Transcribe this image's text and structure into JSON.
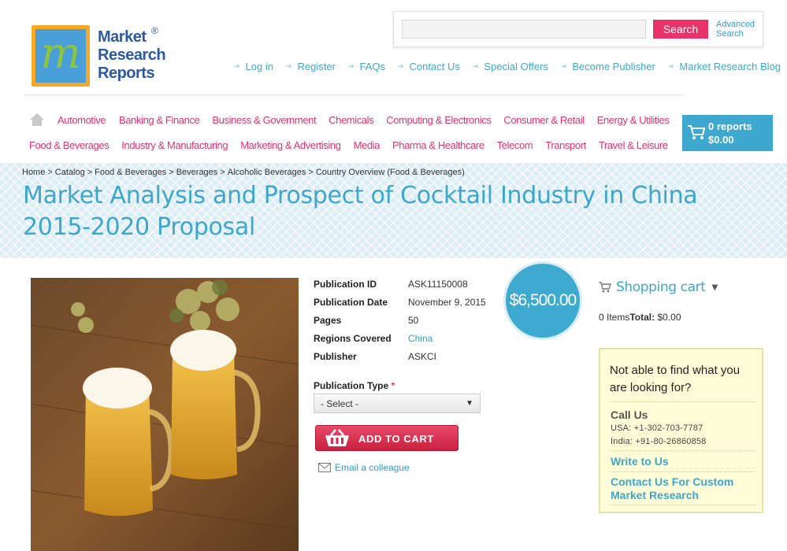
{
  "logo": {
    "line1": "Market",
    "line2": "Research",
    "line3": "Reports",
    "registered": "®"
  },
  "search": {
    "placeholder": "",
    "button": "Search",
    "advanced_line1": "Advanced",
    "advanced_line2": "Search"
  },
  "top_links": [
    "Log in",
    "Register",
    "FAQs",
    "Contact Us",
    "Special Offers",
    "Become Publisher",
    "Market Research Blog"
  ],
  "nav": {
    "row1": [
      "Automotive",
      "Banking & Finance",
      "Business & Government",
      "Chemicals",
      "Computing & Electronics",
      "Consumer & Retail",
      "Energy & Utilities"
    ],
    "row2": [
      "Food & Beverages",
      "Industry & Manufacturing",
      "Marketing & Advertising",
      "Media",
      "Pharma & Healthcare",
      "Telecom",
      "Transport",
      "Travel & Leisure"
    ]
  },
  "cart": {
    "count": "0 reports",
    "total": "$0.00"
  },
  "breadcrumb": [
    "Home",
    "Catalog",
    "Food & Beverages",
    "Beverages",
    "Alcoholic Beverages",
    "Country Overview (Food & Beverages)"
  ],
  "page_title": "Market Analysis and Prospect of Cocktail Industry in China 2015-2020 Proposal",
  "product": {
    "labels": {
      "publication_id": "Publication ID",
      "publication_date": "Publication Date",
      "pages": "Pages",
      "regions": "Regions Covered",
      "publisher": "Publisher"
    },
    "values": {
      "publication_id": "ASK11150008",
      "publication_date": "November 9, 2015",
      "pages": "50",
      "regions": "China",
      "publisher": "ASKCI"
    },
    "price": "$6,500.00",
    "publication_type_label": "Publication Type",
    "required_mark": "*",
    "select_value": "- Select -",
    "add_to_cart": "ADD TO CART",
    "email_colleague": "Email a colleague"
  },
  "shopping_cart": {
    "title": "Shopping cart",
    "items": "0 Items",
    "total_label": "Total:",
    "total_value": "$0.00"
  },
  "help": {
    "question": "Not able to find what you are looking for?",
    "call_us": "Call Us",
    "usa": "USA: +1-302-703-7787",
    "india": "India: +91-80-26860858",
    "write_to_us": "Write to Us",
    "contact_custom": "Contact Us For Custom Market Research"
  },
  "colors": {
    "accent_blue": "#3ea6c9",
    "accent_pink": "#e3336d",
    "logo_orange": "#f7a825"
  }
}
